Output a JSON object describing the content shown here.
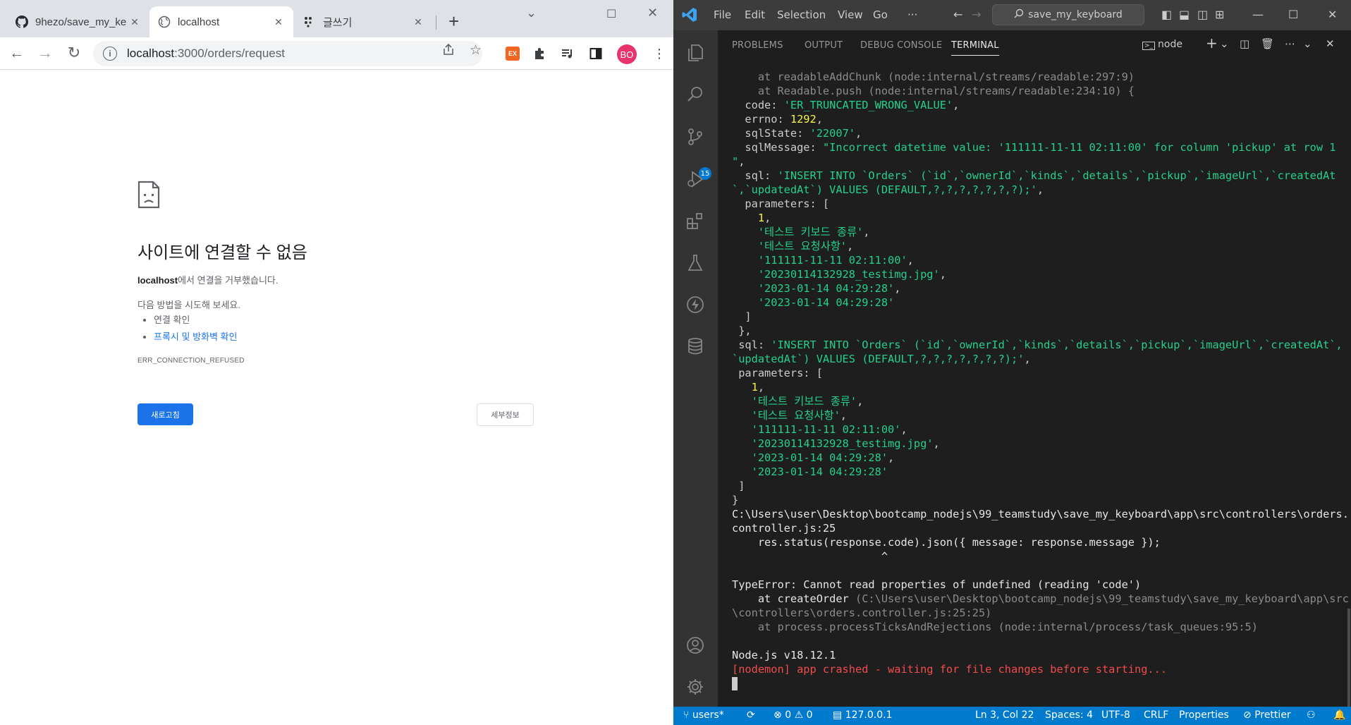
{
  "browser": {
    "tabs": [
      {
        "label": "9hezo/save_my_ke",
        "icon": "github-icon"
      },
      {
        "label": "localhost",
        "icon": "globe-icon"
      },
      {
        "label": "글쓰기",
        "icon": "dots-icon"
      }
    ],
    "url_host": "localhost",
    "url_path": ":3000/orders/request",
    "avatar_initials": "BO",
    "ext_label": "EX",
    "error_page": {
      "title": "사이트에 연결할 수 없음",
      "host_bold": "localhost",
      "description_rest": "에서 연결을 거부했습니다.",
      "try_text": "다음 방법을 시도해 보세요.",
      "suggestions": [
        "연결 확인",
        "프록시 및 방화벽 확인"
      ],
      "error_code": "ERR_CONNECTION_REFUSED",
      "reload_label": "새로고침",
      "details_label": "세부정보"
    }
  },
  "vscode": {
    "menu": [
      "File",
      "Edit",
      "Selection",
      "View",
      "Go",
      "···"
    ],
    "search_label": "save_my_keyboard",
    "scm_badge": "15",
    "panel_tabs": [
      "PROBLEMS",
      "OUTPUT",
      "DEBUG CONSOLE",
      "TERMINAL"
    ],
    "terminal_shell": "node",
    "terminal_lines": [
      [
        {
          "t": "    at readableAddChunk (node:internal/streams/readable:297:9)",
          "c": "t-gray"
        }
      ],
      [
        {
          "t": "    at Readable.push (node:internal/streams/readable:234:10) {",
          "c": "t-gray"
        }
      ],
      [
        {
          "t": "  code: ",
          "c": ""
        },
        {
          "t": "'ER_TRUNCATED_WRONG_VALUE'",
          "c": "t-green"
        },
        {
          "t": ",",
          "c": ""
        }
      ],
      [
        {
          "t": "  errno: ",
          "c": ""
        },
        {
          "t": "1292",
          "c": "t-yellow"
        },
        {
          "t": ",",
          "c": ""
        }
      ],
      [
        {
          "t": "  sqlState: ",
          "c": ""
        },
        {
          "t": "'22007'",
          "c": "t-green"
        },
        {
          "t": ",",
          "c": ""
        }
      ],
      [
        {
          "t": "  sqlMessage: ",
          "c": ""
        },
        {
          "t": "\"Incorrect datetime value: '111111-11-11 02:11:00' for column 'pickup' at row 1",
          "c": "t-green"
        }
      ],
      [
        {
          "t": "\"",
          "c": "t-green"
        },
        {
          "t": ",",
          "c": ""
        }
      ],
      [
        {
          "t": "  sql: ",
          "c": ""
        },
        {
          "t": "'INSERT INTO `Orders` (`id`,`ownerId`,`kinds`,`details`,`pickup`,`imageUrl`,`createdAt",
          "c": "t-green"
        }
      ],
      [
        {
          "t": "`,`updatedAt`) VALUES (DEFAULT,?,?,?,?,?,?,?);'",
          "c": "t-green"
        },
        {
          "t": ",",
          "c": ""
        }
      ],
      [
        {
          "t": "  parameters: [",
          "c": ""
        }
      ],
      [
        {
          "t": "    ",
          "c": ""
        },
        {
          "t": "1",
          "c": "t-yellow"
        },
        {
          "t": ",",
          "c": ""
        }
      ],
      [
        {
          "t": "    ",
          "c": ""
        },
        {
          "t": "'테스트 키보드 종류'",
          "c": "t-green"
        },
        {
          "t": ",",
          "c": ""
        }
      ],
      [
        {
          "t": "    ",
          "c": ""
        },
        {
          "t": "'테스트 요청사항'",
          "c": "t-green"
        },
        {
          "t": ",",
          "c": ""
        }
      ],
      [
        {
          "t": "    ",
          "c": ""
        },
        {
          "t": "'111111-11-11 02:11:00'",
          "c": "t-green"
        },
        {
          "t": ",",
          "c": ""
        }
      ],
      [
        {
          "t": "    ",
          "c": ""
        },
        {
          "t": "'20230114132928_testimg.jpg'",
          "c": "t-green"
        },
        {
          "t": ",",
          "c": ""
        }
      ],
      [
        {
          "t": "    ",
          "c": ""
        },
        {
          "t": "'2023-01-14 04:29:28'",
          "c": "t-green"
        },
        {
          "t": ",",
          "c": ""
        }
      ],
      [
        {
          "t": "    ",
          "c": ""
        },
        {
          "t": "'2023-01-14 04:29:28'",
          "c": "t-green"
        }
      ],
      [
        {
          "t": "  ]",
          "c": ""
        }
      ],
      [
        {
          "t": " },",
          "c": ""
        }
      ],
      [
        {
          "t": " sql: ",
          "c": ""
        },
        {
          "t": "'INSERT INTO `Orders` (`id`,`ownerId`,`kinds`,`details`,`pickup`,`imageUrl`,`createdAt`,",
          "c": "t-green"
        }
      ],
      [
        {
          "t": "`updatedAt`) VALUES (DEFAULT,?,?,?,?,?,?,?);'",
          "c": "t-green"
        },
        {
          "t": ",",
          "c": ""
        }
      ],
      [
        {
          "t": " parameters: [",
          "c": ""
        }
      ],
      [
        {
          "t": "   ",
          "c": ""
        },
        {
          "t": "1",
          "c": "t-yellow"
        },
        {
          "t": ",",
          "c": ""
        }
      ],
      [
        {
          "t": "   ",
          "c": ""
        },
        {
          "t": "'테스트 키보드 종류'",
          "c": "t-green"
        },
        {
          "t": ",",
          "c": ""
        }
      ],
      [
        {
          "t": "   ",
          "c": ""
        },
        {
          "t": "'테스트 요청사항'",
          "c": "t-green"
        },
        {
          "t": ",",
          "c": ""
        }
      ],
      [
        {
          "t": "   ",
          "c": ""
        },
        {
          "t": "'111111-11-11 02:11:00'",
          "c": "t-green"
        },
        {
          "t": ",",
          "c": ""
        }
      ],
      [
        {
          "t": "   ",
          "c": ""
        },
        {
          "t": "'20230114132928_testimg.jpg'",
          "c": "t-green"
        },
        {
          "t": ",",
          "c": ""
        }
      ],
      [
        {
          "t": "   ",
          "c": ""
        },
        {
          "t": "'2023-01-14 04:29:28'",
          "c": "t-green"
        },
        {
          "t": ",",
          "c": ""
        }
      ],
      [
        {
          "t": "   ",
          "c": ""
        },
        {
          "t": "'2023-01-14 04:29:28'",
          "c": "t-green"
        }
      ],
      [
        {
          "t": " ]",
          "c": ""
        }
      ],
      [
        {
          "t": "}",
          "c": ""
        }
      ],
      [
        {
          "t": "C:\\Users\\user\\Desktop\\bootcamp_nodejs\\99_teamstudy\\save_my_keyboard\\app\\src\\controllers\\orders.",
          "c": "t-white"
        }
      ],
      [
        {
          "t": "controller.js:25",
          "c": "t-white"
        }
      ],
      [
        {
          "t": "    res.status(response.code).json({ message: response.message });",
          "c": "t-white"
        }
      ],
      [
        {
          "t": "                       ^",
          "c": "t-white"
        }
      ],
      [
        {
          "t": "",
          "c": ""
        }
      ],
      [
        {
          "t": "TypeError: Cannot read properties of undefined (reading 'code')",
          "c": "t-white"
        }
      ],
      [
        {
          "t": "    at createOrder ",
          "c": "t-white"
        },
        {
          "t": "(C:\\Users\\user\\Desktop\\bootcamp_nodejs\\99_teamstudy\\save_my_keyboard\\app\\src",
          "c": "t-gray"
        }
      ],
      [
        {
          "t": "\\controllers\\orders.controller.js:25:25)",
          "c": "t-gray"
        }
      ],
      [
        {
          "t": "    at process.processTicksAndRejections (node:internal/process/task_queues:95:5)",
          "c": "t-gray"
        }
      ],
      [
        {
          "t": "",
          "c": ""
        }
      ],
      [
        {
          "t": "Node.js v18.12.1",
          "c": "t-white"
        }
      ],
      [
        {
          "t": "[nodemon] app crashed - waiting for file changes before starting...",
          "c": "t-red"
        }
      ]
    ],
    "status": {
      "branch": "users*",
      "errors": "0",
      "warnings": "0",
      "host": "127.0.0.1",
      "position": "Ln 3, Col 22",
      "spaces": "Spaces: 4",
      "encoding": "UTF-8",
      "eol": "CRLF",
      "properties": "Properties",
      "prettier": "Prettier"
    }
  }
}
